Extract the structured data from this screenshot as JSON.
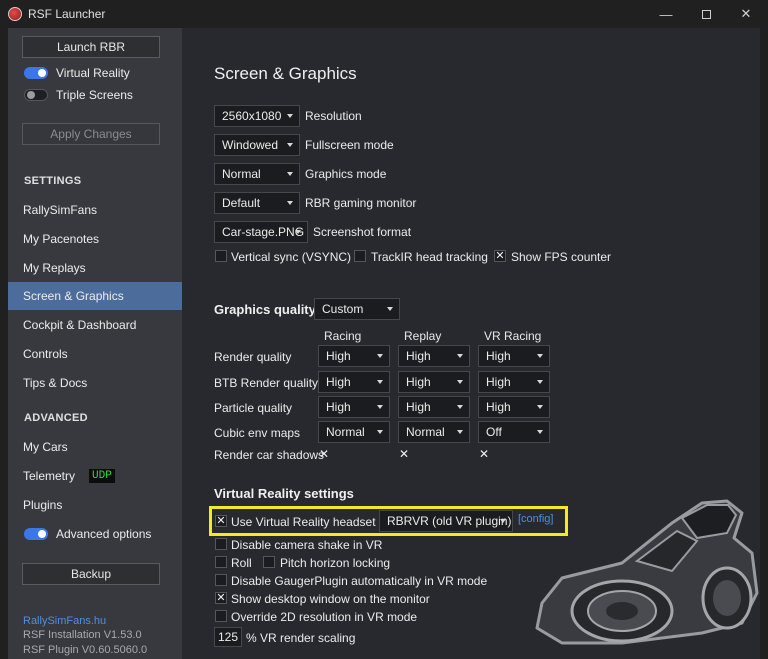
{
  "window": {
    "title": "RSF Launcher",
    "min": "—",
    "close": "✕"
  },
  "sidebar": {
    "launch_label": "Launch RBR",
    "toggles": [
      {
        "label": "Virtual Reality",
        "on": true
      },
      {
        "label": "Triple Screens",
        "on": false
      }
    ],
    "apply_label": "Apply Changes",
    "settings_heading": "SETTINGS",
    "settings_items": [
      {
        "label": "RallySimFans",
        "active": false
      },
      {
        "label": "My Pacenotes",
        "active": false
      },
      {
        "label": "My Replays",
        "active": false
      },
      {
        "label": "Screen & Graphics",
        "active": true
      },
      {
        "label": "Cockpit & Dashboard",
        "active": false
      },
      {
        "label": "Controls",
        "active": false
      },
      {
        "label": "Tips & Docs",
        "active": false
      }
    ],
    "advanced_heading": "ADVANCED",
    "advanced_items": [
      {
        "label": "My Cars"
      },
      {
        "label": "Telemetry",
        "badge": "UDP"
      },
      {
        "label": "Plugins"
      }
    ],
    "advanced_toggle": {
      "label": "Advanced options",
      "on": true
    },
    "backup_label": "Backup",
    "footer_link": "RallySimFans.hu",
    "installation": "RSF Installation V1.53.0",
    "plugin": "RSF Plugin V0.60.5060.0"
  },
  "main": {
    "title": "Screen & Graphics",
    "display_settings": [
      {
        "value": "2560x1080",
        "label": "Resolution"
      },
      {
        "value": "Windowed",
        "label": "Fullscreen mode"
      },
      {
        "value": "Normal",
        "label": "Graphics mode"
      },
      {
        "value": "Default",
        "label": "RBR gaming monitor"
      },
      {
        "value": "Car-stage.PNG",
        "label": "Screenshot format"
      }
    ],
    "checks": [
      {
        "label": "Vertical sync (VSYNC)",
        "checked": false
      },
      {
        "label": "TrackIR head tracking",
        "checked": false
      },
      {
        "label": "Show FPS counter",
        "checked": true
      }
    ],
    "quality": {
      "heading": "Graphics quality",
      "preset": "Custom",
      "columns": [
        "Racing",
        "Replay",
        "VR Racing"
      ],
      "rows": [
        {
          "label": "Render quality",
          "values": [
            "High",
            "High",
            "High"
          ]
        },
        {
          "label": "BTB Render quality",
          "values": [
            "High",
            "High",
            "High"
          ]
        },
        {
          "label": "Particle quality",
          "values": [
            "High",
            "High",
            "High"
          ]
        },
        {
          "label": "Cubic env maps",
          "values": [
            "Normal",
            "Normal",
            "Off"
          ]
        }
      ],
      "shadows_label": "Render car shadows",
      "shadows": [
        true,
        true,
        true
      ]
    },
    "vr": {
      "heading": "Virtual Reality settings",
      "use_headset_label": "Use Virtual Reality headset",
      "use_headset": true,
      "plugin_value": "RBRVR (old VR plugin)",
      "config_link": "[config]",
      "options": [
        {
          "label": "Disable camera shake in VR",
          "checked": false
        },
        {
          "label": "Roll",
          "checked": false
        },
        {
          "label": "Pitch horizon locking",
          "checked": false
        },
        {
          "label": "Disable GaugerPlugin automatically in VR mode",
          "checked": false
        },
        {
          "label": "Show desktop window on the monitor",
          "checked": true
        },
        {
          "label": "Override 2D resolution in VR mode",
          "checked": false
        }
      ],
      "scaling_value": "125",
      "scaling_label": "% VR render scaling"
    }
  },
  "colors": {
    "accent": "#3b78e7",
    "active_nav": "#4c6d9c",
    "highlight": "#f0ec24",
    "link": "#4f8fe0",
    "udp": "#2adf3a"
  },
  "icons": {
    "app": "rsf-logo-icon",
    "checkmark": "✕",
    "caret": "caret-down-icon"
  }
}
